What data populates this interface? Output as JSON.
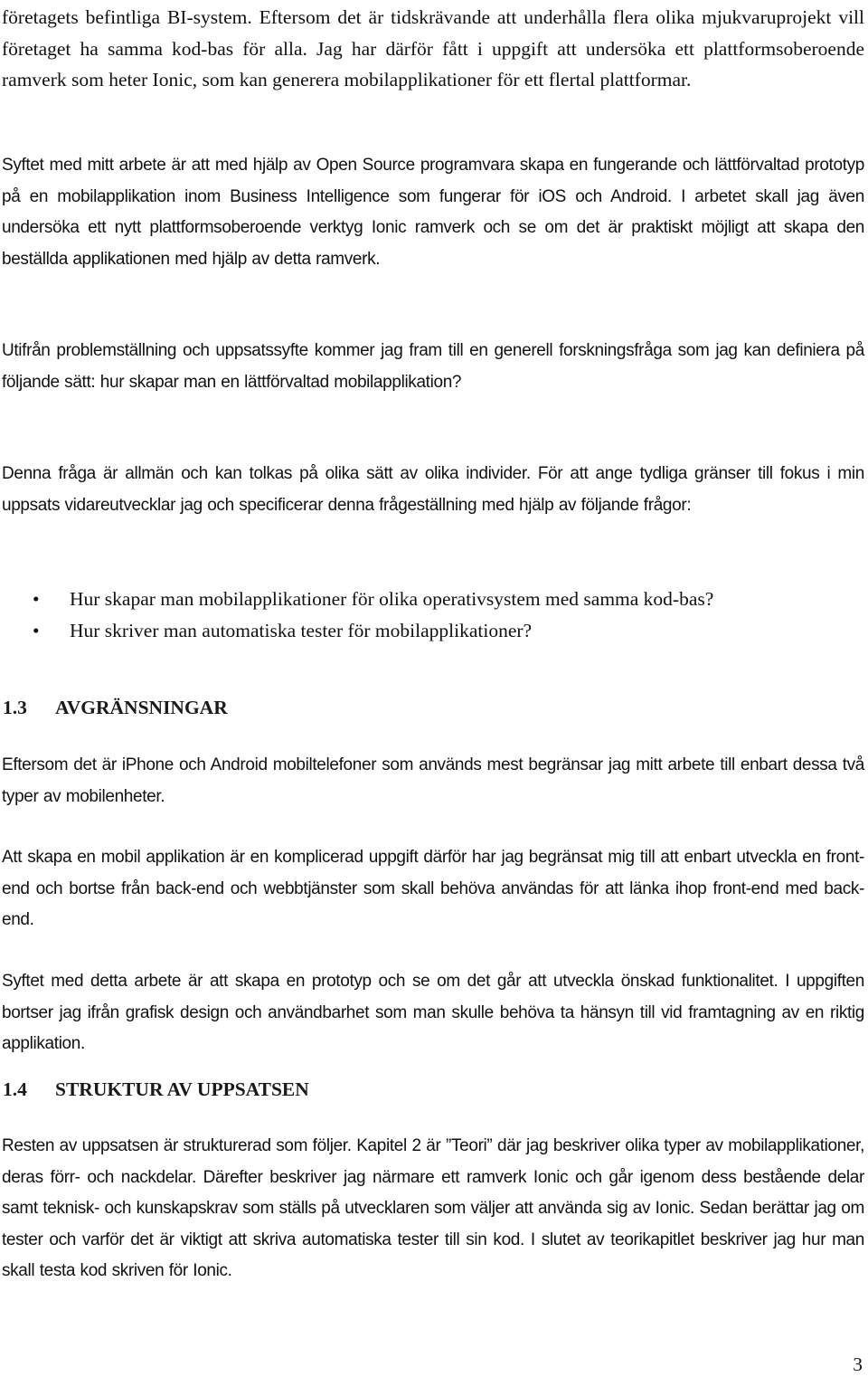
{
  "document": {
    "intro_paragraph": "företagets befintliga BI-system. Eftersom det är tidskrävande att underhålla flera olika mjukvaruprojekt vill företaget ha samma kod-bas för alla. Jag har därför fått i uppgift att undersöka ett plattformsoberoende ramverk som heter Ionic, som kan generera mobilapplikationer för ett flertal plattformar.",
    "purpose_paragraph": "Syftet med mitt arbete är att med hjälp av Open Source programvara skapa en fungerande och lättförvaltad prototyp på en mobilapplikation inom Business Intelligence som fungerar för iOS och Android. I arbetet skall jag även undersöka ett nytt plattformsoberoende verktyg Ionic ramverk och se om det är praktiskt möjligt att skapa den beställda applikationen med hjälp av detta ramverk.",
    "research_question_paragraph": "Utifrån problemställning och uppsatssyfte kommer jag fram till en generell forskningsfråga som jag kan definiera på följande sätt: hur skapar man en lättförvaltad mobilapplikation?",
    "specification_paragraph": "Denna fråga är allmän och kan tolkas på olika sätt av olika individer. För att ange tydliga gränser till fokus i min uppsats vidareutvecklar jag och specificerar denna frågeställning med hjälp av följande frågor:",
    "questions": [
      {
        "bullet": "•",
        "text": "Hur skapar man mobilapplikationer för olika operativsystem med samma kod-bas?"
      },
      {
        "bullet": "•",
        "text": "Hur skriver man automatiska tester för mobilapplikationer?"
      }
    ],
    "section_1_3": {
      "number": "1.3",
      "title": "AVGRÄNSNINGAR",
      "paragraphs": [
        "Eftersom det är iPhone och Android mobiltelefoner som används mest begränsar jag mitt arbete till enbart dessa två typer av mobilenheter.",
        "Att skapa en mobil applikation är en komplicerad uppgift därför har jag begränsat mig till att enbart utveckla en front-end och bortse från back-end och webbtjänster som skall behöva användas för att länka ihop front-end med back-end.",
        "Syftet med detta arbete är att skapa en prototyp och se om det går att utveckla önskad funktionalitet. I uppgiften bortser jag ifrån grafisk design och användbarhet som man skulle behöva ta hänsyn till vid framtagning av en riktig applikation."
      ]
    },
    "section_1_4": {
      "number": "1.4",
      "title": "STRUKTUR AV UPPSATSEN",
      "paragraphs": [
        "Resten av uppsatsen är strukturerad som följer. Kapitel 2 är ”Teori” där jag beskriver olika typer av mobilapplikationer, deras förr- och nackdelar. Därefter beskriver jag närmare ett ramverk Ionic och går igenom dess bestående delar samt teknisk- och kunskapskrav som ställs på utvecklaren som väljer att använda sig av Ionic. Sedan berättar jag om tester och varför det är viktigt att skriva automatiska tester till sin kod. I slutet av teorikapitlet beskriver jag hur man skall testa kod skriven för Ionic."
      ]
    },
    "page_number": "3"
  }
}
